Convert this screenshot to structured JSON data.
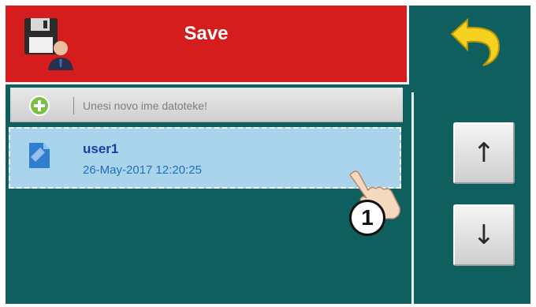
{
  "header": {
    "title": "Save"
  },
  "new_file": {
    "placeholder": "Unesi novo ime datoteke!"
  },
  "files": [
    {
      "name": "user1",
      "date": "26-May-2017 12:20:25"
    }
  ],
  "nav": {
    "up_glyph": "↑",
    "down_glyph": "↓"
  },
  "callout": {
    "number": "1"
  },
  "colors": {
    "background": "#0f5f5e",
    "header": "#d51d1d",
    "selected_row": "#a9d4eb",
    "file_name": "#1a3ea6",
    "file_date": "#1f6fc0",
    "back_arrow": "#f5d21f"
  },
  "icons": {
    "header": "save-disk-user-icon",
    "back": "back-arrow-icon",
    "add": "plus-icon",
    "file": "file-icon"
  }
}
